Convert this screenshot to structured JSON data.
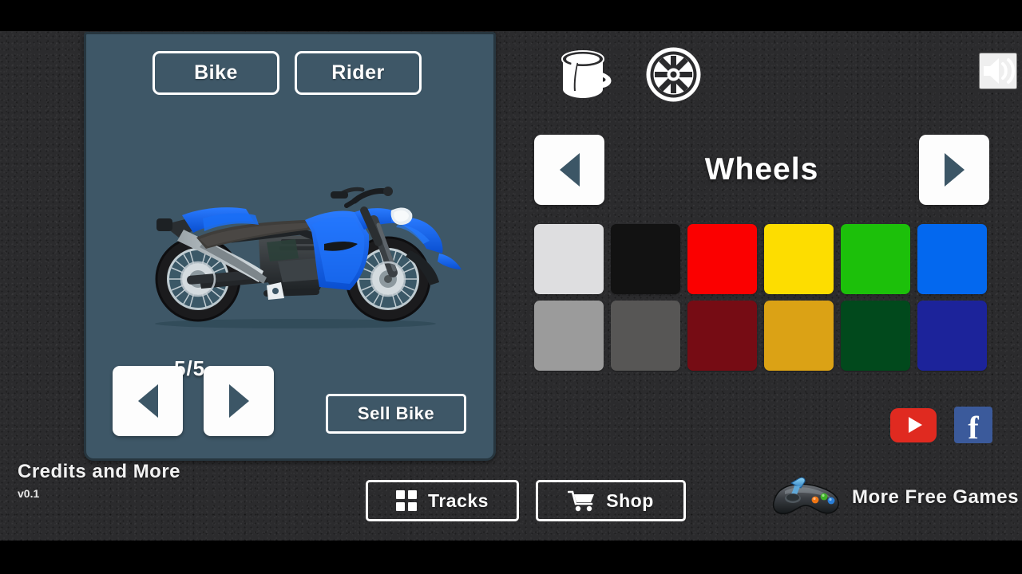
{
  "app": {
    "version": "v0.1"
  },
  "bike_panel": {
    "tabs": [
      {
        "label": "Bike",
        "name": "tab-bike",
        "active": true
      },
      {
        "label": "Rider",
        "name": "tab-rider",
        "active": false
      }
    ],
    "bike_counter": "5/5",
    "bike_index": 5,
    "bike_total": 5,
    "bike_body_color": "#1565f0",
    "prev_icon": "triangle-left-icon",
    "next_icon": "triangle-right-icon",
    "sell_bike_label": "Sell Bike",
    "panel_color": "#3e5767"
  },
  "customize": {
    "icons": [
      {
        "name": "paint-bucket-icon",
        "label": "Paint"
      },
      {
        "name": "wheel-icon",
        "label": "Wheels"
      }
    ],
    "sound_icon": "speaker-on-icon",
    "category": "Wheels",
    "prev_icon": "triangle-left-icon",
    "next_icon": "triangle-right-icon",
    "swatches": [
      {
        "color": "#dedee0",
        "label": "white"
      },
      {
        "color": "#121212",
        "label": "black"
      },
      {
        "color": "#fb0000",
        "label": "red"
      },
      {
        "color": "#fddd00",
        "label": "yellow"
      },
      {
        "color": "#1cc00a",
        "label": "green"
      },
      {
        "color": "#0368ef",
        "label": "blue"
      },
      {
        "color": "#9b9b9b",
        "label": "gray"
      },
      {
        "color": "#575655",
        "label": "dark-gray"
      },
      {
        "color": "#760c14",
        "label": "dark-red"
      },
      {
        "color": "#dba215",
        "label": "gold"
      },
      {
        "color": "#01491c",
        "label": "dark-green"
      },
      {
        "color": "#1c239a",
        "label": "dark-blue"
      }
    ]
  },
  "social": {
    "youtube_label": "YouTube",
    "youtube_color": "#e02a20",
    "facebook_label": "f",
    "facebook_color": "#3b5a9b"
  },
  "bottom_bar": {
    "credits_label": "Credits and More",
    "tracks_label": "Tracks",
    "tracks_icon": "grid-icon",
    "shop_label": "Shop",
    "shop_icon": "cart-icon",
    "more_games_label": "More Free Games",
    "more_games_icon": "gamepad-icon"
  }
}
